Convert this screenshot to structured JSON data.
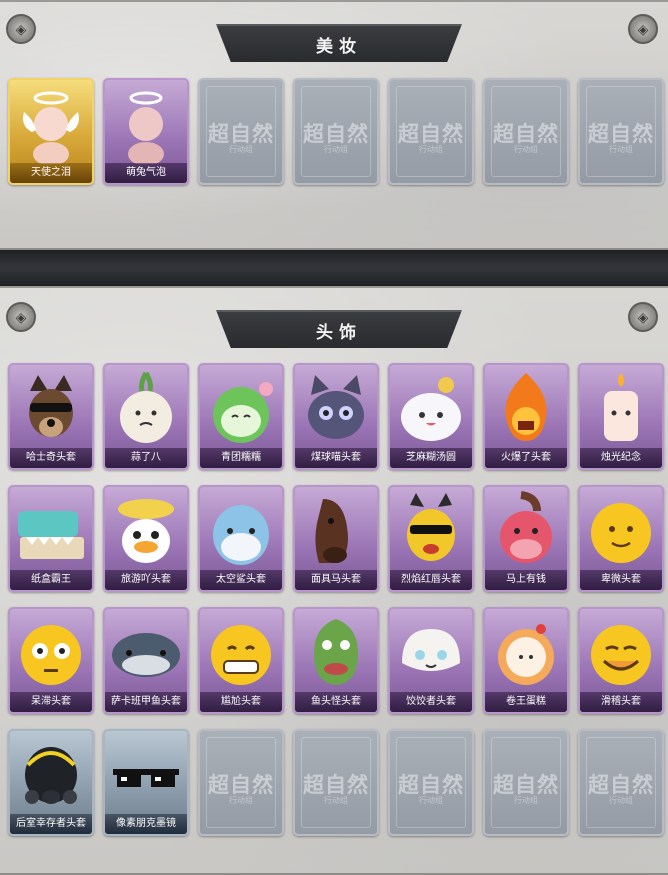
{
  "sections": {
    "makeup": {
      "title": "美妆",
      "items": [
        {
          "label": "天使之泪",
          "rarity": "gold",
          "icon": "angel-halo-icon"
        },
        {
          "label": "萌兔气泡",
          "rarity": "purple",
          "icon": "bubble-head-icon"
        },
        {
          "label": "",
          "rarity": "empty"
        },
        {
          "label": "",
          "rarity": "empty"
        },
        {
          "label": "",
          "rarity": "empty"
        },
        {
          "label": "",
          "rarity": "empty"
        },
        {
          "label": "",
          "rarity": "empty"
        }
      ]
    },
    "headwear": {
      "title": "头饰",
      "items": [
        {
          "label": "哈士奇头套",
          "rarity": "purple",
          "icon": "husky-head-icon"
        },
        {
          "label": "蒜了八",
          "rarity": "purple",
          "icon": "garlic-head-icon"
        },
        {
          "label": "青团糯糯",
          "rarity": "purple",
          "icon": "green-dumpling-icon"
        },
        {
          "label": "煤球喵头套",
          "rarity": "purple",
          "icon": "cat-head-icon"
        },
        {
          "label": "芝麻糊汤圆",
          "rarity": "purple",
          "icon": "tangyuan-icon"
        },
        {
          "label": "火爆了头套",
          "rarity": "purple",
          "icon": "fire-head-icon"
        },
        {
          "label": "烛光纪念",
          "rarity": "purple",
          "icon": "candle-head-icon"
        },
        {
          "label": "纸盒霸王",
          "rarity": "purple",
          "icon": "box-dinosaur-icon"
        },
        {
          "label": "旅游吖头套",
          "rarity": "purple",
          "icon": "duck-hat-icon"
        },
        {
          "label": "太空鲨头套",
          "rarity": "purple",
          "icon": "shark-head-icon"
        },
        {
          "label": "面具马头套",
          "rarity": "purple",
          "icon": "horse-mask-icon"
        },
        {
          "label": "烈焰红唇头套",
          "rarity": "purple",
          "icon": "yellow-mouse-icon"
        },
        {
          "label": "马上有钱",
          "rarity": "purple",
          "icon": "pink-horse-icon"
        },
        {
          "label": "卑微头套",
          "rarity": "purple",
          "icon": "smile-emoji-icon"
        },
        {
          "label": "呆滞头套",
          "rarity": "purple",
          "icon": "stare-emoji-icon"
        },
        {
          "label": "萨卡班甲鱼头套",
          "rarity": "purple",
          "icon": "fish-head-icon"
        },
        {
          "label": "尴尬头套",
          "rarity": "purple",
          "icon": "grimace-emoji-icon"
        },
        {
          "label": "鱼头怪头套",
          "rarity": "purple",
          "icon": "fish-monster-icon"
        },
        {
          "label": "饺饺者头套",
          "rarity": "purple",
          "icon": "dumpling-icon"
        },
        {
          "label": "卷王蛋糕",
          "rarity": "purple",
          "icon": "cake-roll-icon"
        },
        {
          "label": "滑稽头套",
          "rarity": "purple",
          "icon": "funny-emoji-icon"
        },
        {
          "label": "后室幸存者头套",
          "rarity": "blue",
          "icon": "gas-mask-icon"
        },
        {
          "label": "像素朋克墨镜",
          "rarity": "blue",
          "icon": "pixel-glasses-icon"
        },
        {
          "label": "",
          "rarity": "empty"
        },
        {
          "label": "",
          "rarity": "empty"
        },
        {
          "label": "",
          "rarity": "empty"
        },
        {
          "label": "",
          "rarity": "empty"
        },
        {
          "label": "",
          "rarity": "empty"
        }
      ]
    }
  },
  "empty_slot": {
    "watermark": "超自然",
    "watermark_sub": "行动组"
  },
  "colors": {
    "gold": "#d8a93a",
    "purple": "#9a74b4",
    "blue": "#8a9aa9",
    "empty": "#959ba4",
    "banner": "#2f3034"
  }
}
